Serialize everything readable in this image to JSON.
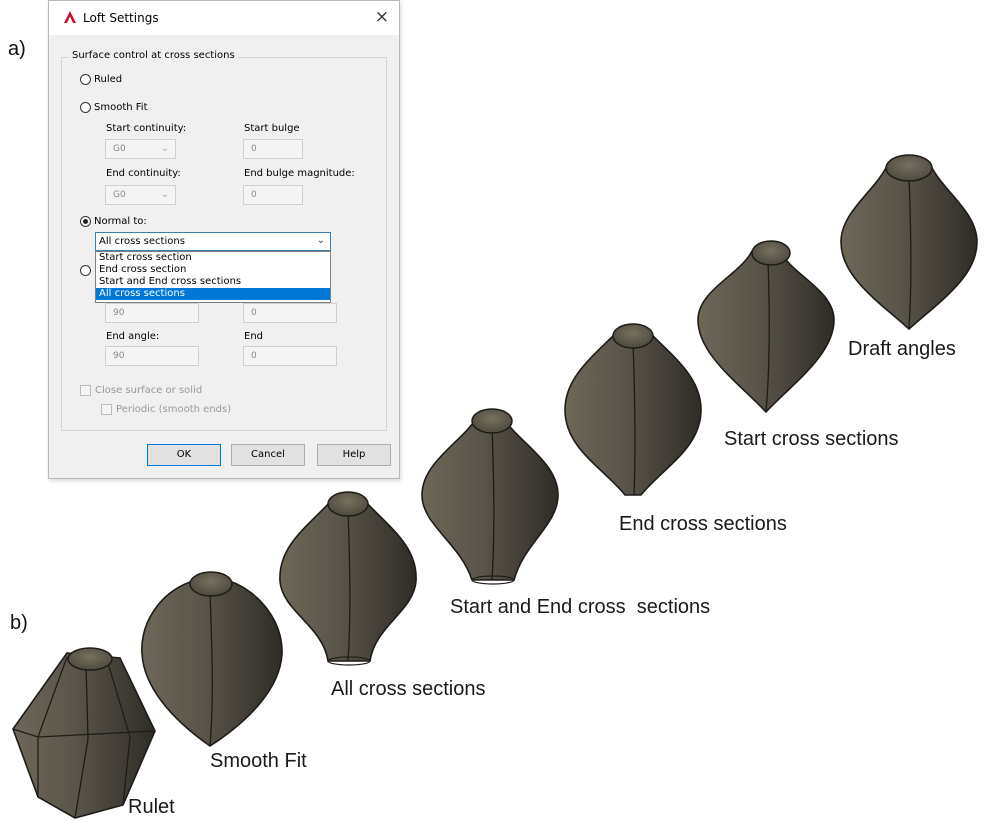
{
  "panel_labels": {
    "a": "a)",
    "b": "b)"
  },
  "dialog": {
    "title": "Loft Settings",
    "close_glyph": "×",
    "group_title": "Surface control at cross sections",
    "ruled_label": "Ruled",
    "smooth_fit_label": "Smooth Fit",
    "start_continuity_label": "Start continuity:",
    "start_continuity_value": "G0",
    "start_bulge_label": "Start bulge",
    "start_bulge_value": "0",
    "end_continuity_label": "End continuity:",
    "end_continuity_value": "G0",
    "end_bulge_label": "End bulge magnitude:",
    "end_bulge_value": "0",
    "normal_to_label": "Normal to:",
    "normal_to_selected": "All cross sections",
    "normal_to_options": [
      "Start cross section",
      "End cross section",
      "Start and End cross sections",
      "All cross sections"
    ],
    "start_angle_value": "90",
    "start_magnitude_value": "0",
    "end_angle_label": "End angle:",
    "end_angle_value": "90",
    "end_magnitude_label": "End",
    "end_magnitude_value": "0",
    "close_surface_label": "Close surface or solid",
    "periodic_label": "Periodic (smooth ends)",
    "ok_label": "OK",
    "cancel_label": "Cancel",
    "help_label": "Help"
  },
  "shape_labels": [
    "Rulet",
    "Smooth Fit",
    "All cross sections",
    "Start and End cross  sections",
    "End cross sections",
    "Start cross sections",
    "Draft angles"
  ],
  "colors": {
    "shape_fill": "#5a5548",
    "shape_dark": "#3a3630",
    "accent": "#0078d7",
    "app_icon": "#c8102e"
  }
}
